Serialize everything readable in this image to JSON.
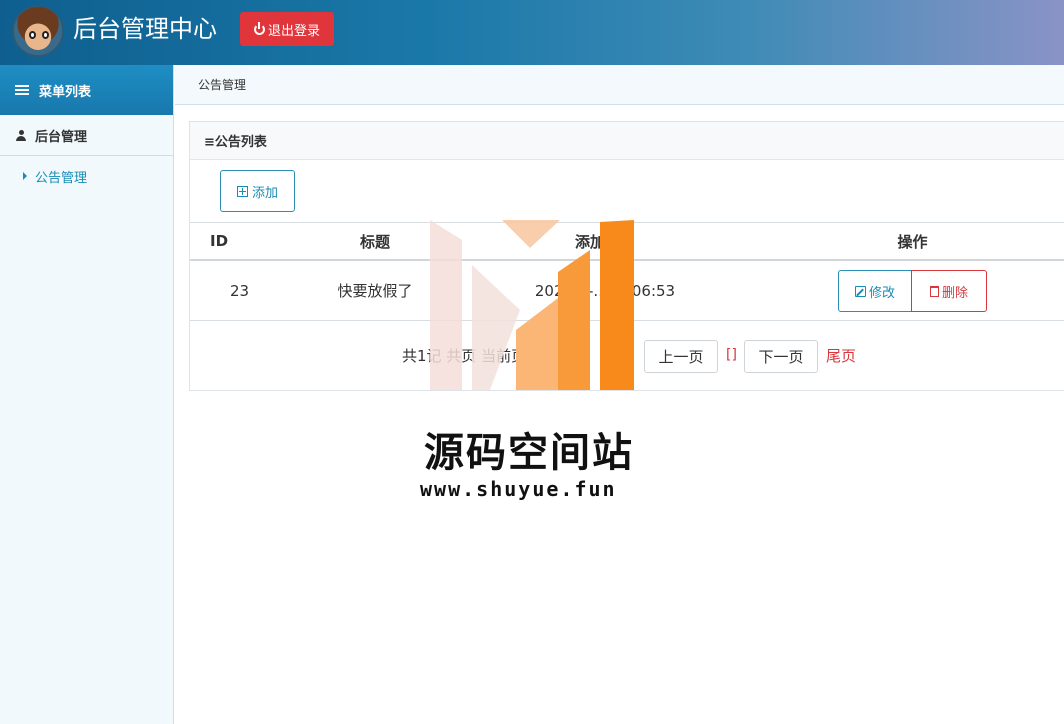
{
  "header": {
    "app_title": "后台管理中心",
    "logout_label": "退出登录"
  },
  "sidebar": {
    "menu_title": "菜单列表",
    "group_title": "后台管理",
    "items": [
      {
        "label": "公告管理"
      }
    ]
  },
  "breadcrumb": {
    "current": "公告管理"
  },
  "panel": {
    "title": "≡公告列表",
    "add_label": "添加",
    "table": {
      "columns": [
        "ID",
        "标题",
        "添加时间",
        "操作"
      ],
      "rows": [
        {
          "id": "23",
          "title": "快要放假了",
          "time": "2020-..-.. 14:06:53",
          "edit_label": "修改",
          "delete_label": "删除"
        }
      ]
    },
    "pager": {
      "info": "共1记 共页 当前页 首页",
      "prev_label": "上一页",
      "current_marker": "[]",
      "next_label": "下一页",
      "last_label": "尾页"
    }
  },
  "watermark": {
    "name": "源码空间站",
    "url": "www.shuyue.fun"
  },
  "colors": {
    "accent": "#1a8cb5",
    "danger": "#d9363e",
    "header_start": "#0e5f8f",
    "header_end": "#8a93c6"
  }
}
